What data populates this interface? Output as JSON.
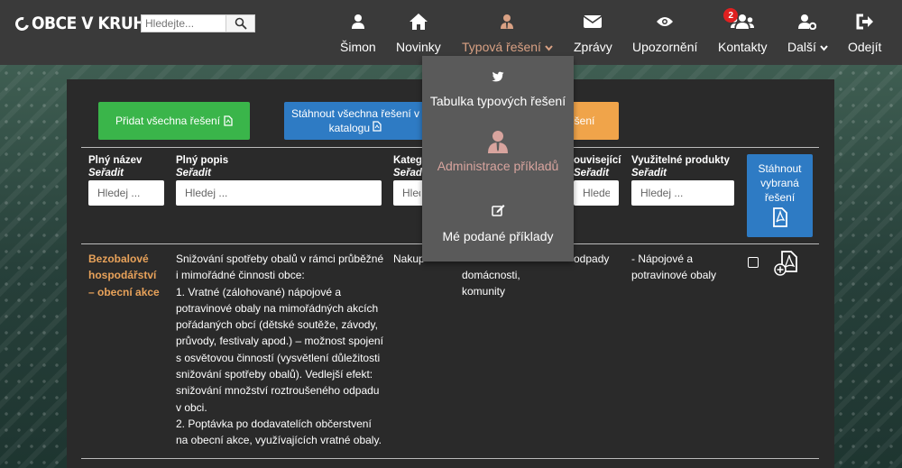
{
  "app": {
    "logo_text": "OBCE V KRUHU"
  },
  "search": {
    "placeholder": "Hledejte..."
  },
  "nav": [
    {
      "label": "Šimon",
      "icon": "user-icon"
    },
    {
      "label": "Novinky",
      "icon": "home-icon"
    },
    {
      "label": "Typová řešení",
      "icon": "user-tie-icon",
      "active": true
    },
    {
      "label": "Zprávy",
      "icon": "envelope-icon"
    },
    {
      "label": "Upozornění",
      "icon": "eye-icon"
    },
    {
      "label": "Kontakty",
      "icon": "users-icon",
      "badge": "2"
    },
    {
      "label": "Další",
      "icon": "user-gear-icon"
    },
    {
      "label": "Odejít",
      "icon": "sign-out-icon"
    }
  ],
  "dropdown": [
    {
      "label": "Tabulka typových řešení",
      "icon": "twitter-icon"
    },
    {
      "label": "Administrace příkladů",
      "icon": "user-tie-icon",
      "disabled": true
    },
    {
      "label": "Mé podané příklady",
      "icon": "edit-icon"
    }
  ],
  "actions": {
    "add_all": "Přidat všechna řešení",
    "download_all_line1": "Stáhnout všechna řešení v",
    "download_all_line2": "katalogu",
    "third": "řešení"
  },
  "table": {
    "sort_label": "Seřadit",
    "filter_placeholder": "Hledej ...",
    "columns": [
      {
        "name": "Plný název"
      },
      {
        "name": "Plný popis"
      },
      {
        "name": "Kateg"
      },
      {
        "name": "ouvisející"
      },
      {
        "name": "Využitelné produkty"
      }
    ],
    "download_selected": [
      "Stáhnout",
      "vybraná",
      "řešení"
    ],
    "rows": [
      {
        "name": [
          "Bezobalové",
          "hospodářství",
          "– obecní akce"
        ],
        "description": [
          "Snižování spotřeby obalů v rámci průběžné",
          "i mimořádné činnosti obce:",
          "1. Vratné (zálohované) nápojové a",
          "potravinové obaly na mimořádných akcích",
          "pořádaných obcí (dětské soutěže, závody,",
          "průvody, festivaly apod.) – možnost spojení",
          "s osvětovou činností (vysvětlení důležitosti",
          "snižování spotřeby obalů). Vedlejší efekt:",
          "snižování množství roztroušeného odpadu",
          "v obci.",
          "2. Poptávka po dodavatelích občerstvení",
          "na obecní akce, využívajících vratné obaly."
        ],
        "category": "Nakup",
        "target": [
          "domácnosti,",
          "komunity"
        ],
        "related": "odpady",
        "products": [
          "- Nápojové a",
          "potravinové obaly"
        ]
      }
    ]
  }
}
